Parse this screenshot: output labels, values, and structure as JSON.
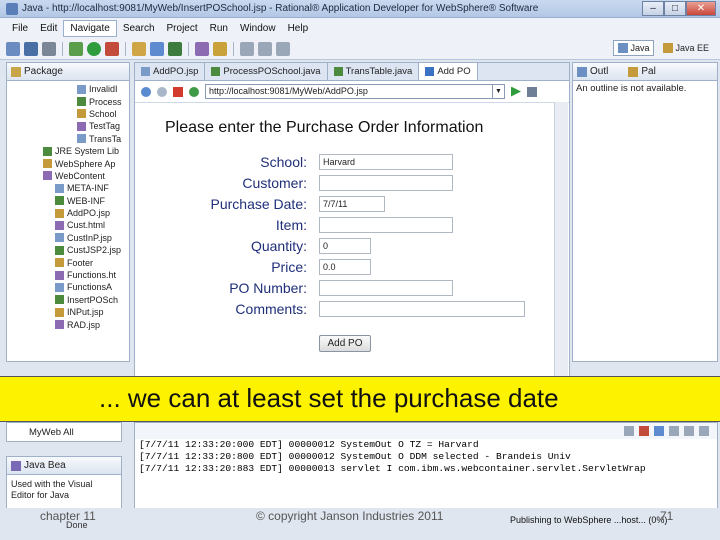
{
  "window": {
    "title": "Java - http://localhost:9081/MyWeb/InsertPOSchool.jsp - Rational® Application Developer for WebSphere® Software"
  },
  "menu": [
    "File",
    "Edit",
    "Navigate",
    "Search",
    "Project",
    "Run",
    "Window",
    "Help"
  ],
  "perspectives": [
    {
      "label": "Java",
      "active": true
    },
    {
      "label": "Java EE",
      "active": false
    }
  ],
  "package_explorer": {
    "tab": "Package",
    "items": [
      "InvalidI",
      "Process",
      "School",
      "TestTag",
      "TransTa",
      "JRE System Lib",
      "WebSphere Ap",
      "WebContent",
      "META-INF",
      "WEB-INF",
      "AddPO.jsp",
      "Cust.html",
      "CustInP.jsp",
      "CustJSP2.jsp",
      "Footer",
      "Functions.ht",
      "FunctionsA",
      "InsertPOSch",
      "INPut.jsp",
      "RAD.jsp"
    ]
  },
  "editor": {
    "tabs": [
      {
        "label": "AddPO.jsp",
        "active": false
      },
      {
        "label": "ProcessPOSchool.java",
        "active": false
      },
      {
        "label": "TransTable.java",
        "active": false
      },
      {
        "label": "Add PO",
        "active": true
      }
    ],
    "url": "http://localhost:9081/MyWeb/AddPO.jsp"
  },
  "form": {
    "heading": "Please enter the Purchase Order Information",
    "fields": [
      {
        "label": "School:",
        "value": "Harvard"
      },
      {
        "label": "Customer:",
        "value": ""
      },
      {
        "label": "Purchase Date:",
        "value": "7/7/11"
      },
      {
        "label": "Item:",
        "value": ""
      },
      {
        "label": "Quantity:",
        "value": "0"
      },
      {
        "label": "Price:",
        "value": "0.0"
      },
      {
        "label": "PO Number:",
        "value": ""
      },
      {
        "label": "Comments:",
        "value": ""
      }
    ],
    "button": "Add PO"
  },
  "outline": {
    "tabs": [
      "Outl",
      "Pal"
    ],
    "note": "An outline is not available."
  },
  "caption": "... we can at least set the purchase date",
  "lower_left": {
    "item": "MyWeb All"
  },
  "javabean": {
    "tab": "Java Bea",
    "text": "Used with the Visual Editor for Java"
  },
  "console": {
    "lines": [
      "[7/7/11 12:33:20:000 EDT] 00000012 SystemOut     O TZ = Harvard",
      "[7/7/11 12:33:20:800 EDT] 00000012 SystemOut     O DDM selected - Brandeis Univ",
      "[7/7/11 12:33:20:883 EDT] 00000013 servlet       I com.ibm.ws.webcontainer.servlet.ServletWrap"
    ]
  },
  "footer": {
    "chapter": "chapter 11",
    "done": "Done",
    "copyright": "© copyright Janson Industries 2011",
    "publishing": "Publishing to WebSphere ...host... (0%)",
    "page": "71"
  },
  "colors": {
    "caption_bg": "#fdf300",
    "label_blue": "#1f2f7a"
  }
}
